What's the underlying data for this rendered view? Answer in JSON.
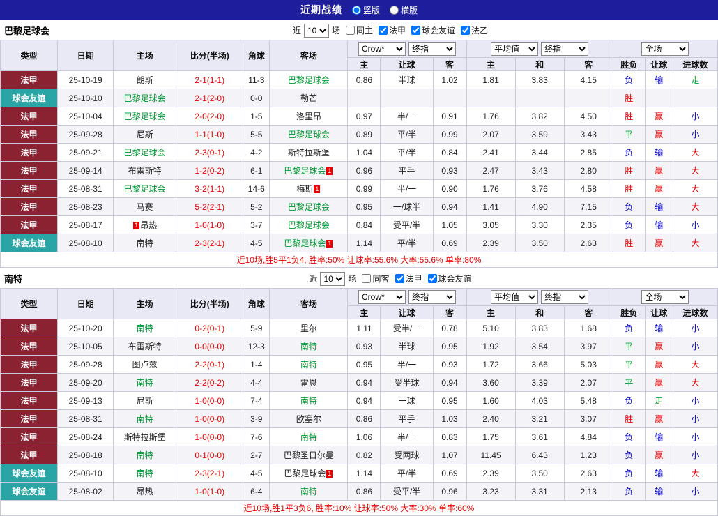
{
  "titlebar": {
    "title": "近期战绩",
    "radios": [
      {
        "label": "竖版",
        "selected": true
      },
      {
        "label": "横版",
        "selected": false
      }
    ]
  },
  "badge_text": "1",
  "colors": {
    "titlebar_bg": "#1e1e9c",
    "league": {
      "法甲": "#8b2232",
      "球会友谊": "#2aa5a5",
      "法乙": "#8b2232"
    },
    "team_highlight": "#009933",
    "score": "#e60000",
    "result": {
      "胜": "#e60000",
      "赢": "#e60000",
      "大": "#e60000",
      "平": "#009933",
      "走": "#009933",
      "负": "#0000cc",
      "输": "#0000cc",
      "小": "#0000cc"
    }
  },
  "sections": [
    {
      "team": "巴黎足球会",
      "filter": {
        "prefix": "近",
        "matches_value": "10",
        "suffix": "场",
        "checkboxes": [
          {
            "label": "同主",
            "checked": false
          },
          {
            "label": "法甲",
            "checked": true
          },
          {
            "label": "球会友谊",
            "checked": true
          },
          {
            "label": "法乙",
            "checked": true
          }
        ]
      },
      "header": {
        "static_cols": [
          "类型",
          "日期",
          "主场",
          "比分(半场)",
          "角球",
          "客场"
        ],
        "asian_dropdowns": [
          "Crow*",
          "终指"
        ],
        "euro_dropdowns": [
          "平均值",
          "终指"
        ],
        "fulltime_dropdown": "全场",
        "asian_sub": [
          "主",
          "让球",
          "客"
        ],
        "euro_sub": [
          "主",
          "和",
          "客"
        ],
        "result_sub": [
          "胜负",
          "让球",
          "进球数"
        ]
      },
      "rows": [
        {
          "league": "法甲",
          "date": "25-10-19",
          "home": {
            "name": "朗斯",
            "hl": false,
            "badge": null
          },
          "score": "2-1(1-1)",
          "corner": "11-3",
          "away": {
            "name": "巴黎足球会",
            "hl": true,
            "badge": null
          },
          "asian": [
            "0.86",
            "半球",
            "1.02"
          ],
          "euro": [
            "1.81",
            "3.83",
            "4.15"
          ],
          "results": [
            "负",
            "输",
            "走"
          ]
        },
        {
          "league": "球会友谊",
          "date": "25-10-10",
          "home": {
            "name": "巴黎足球会",
            "hl": true,
            "badge": null
          },
          "score": "2-1(2-0)",
          "corner": "0-0",
          "away": {
            "name": "勒芒",
            "hl": false,
            "badge": null
          },
          "asian": [
            "",
            "",
            ""
          ],
          "euro": [
            "",
            "",
            ""
          ],
          "results": [
            "胜",
            "",
            ""
          ]
        },
        {
          "league": "法甲",
          "date": "25-10-04",
          "home": {
            "name": "巴黎足球会",
            "hl": true,
            "badge": null
          },
          "score": "2-0(2-0)",
          "corner": "1-5",
          "away": {
            "name": "洛里昂",
            "hl": false,
            "badge": null
          },
          "asian": [
            "0.97",
            "半/一",
            "0.91"
          ],
          "euro": [
            "1.76",
            "3.82",
            "4.50"
          ],
          "results": [
            "胜",
            "赢",
            "小"
          ]
        },
        {
          "league": "法甲",
          "date": "25-09-28",
          "home": {
            "name": "尼斯",
            "hl": false,
            "badge": null
          },
          "score": "1-1(1-0)",
          "corner": "5-5",
          "away": {
            "name": "巴黎足球会",
            "hl": true,
            "badge": null
          },
          "asian": [
            "0.89",
            "平/半",
            "0.99"
          ],
          "euro": [
            "2.07",
            "3.59",
            "3.43"
          ],
          "results": [
            "平",
            "赢",
            "小"
          ]
        },
        {
          "league": "法甲",
          "date": "25-09-21",
          "home": {
            "name": "巴黎足球会",
            "hl": true,
            "badge": null
          },
          "score": "2-3(0-1)",
          "corner": "4-2",
          "away": {
            "name": "斯特拉斯堡",
            "hl": false,
            "badge": null
          },
          "asian": [
            "1.04",
            "平/半",
            "0.84"
          ],
          "euro": [
            "2.41",
            "3.44",
            "2.85"
          ],
          "results": [
            "负",
            "输",
            "大"
          ]
        },
        {
          "league": "法甲",
          "date": "25-09-14",
          "home": {
            "name": "布雷斯特",
            "hl": false,
            "badge": null
          },
          "score": "1-2(0-2)",
          "corner": "6-1",
          "away": {
            "name": "巴黎足球会",
            "hl": true,
            "badge": "after"
          },
          "asian": [
            "0.96",
            "平手",
            "0.93"
          ],
          "euro": [
            "2.47",
            "3.43",
            "2.80"
          ],
          "results": [
            "胜",
            "赢",
            "大"
          ]
        },
        {
          "league": "法甲",
          "date": "25-08-31",
          "home": {
            "name": "巴黎足球会",
            "hl": true,
            "badge": null
          },
          "score": "3-2(1-1)",
          "corner": "14-6",
          "away": {
            "name": "梅斯",
            "hl": false,
            "badge": "after"
          },
          "asian": [
            "0.99",
            "半/一",
            "0.90"
          ],
          "euro": [
            "1.76",
            "3.76",
            "4.58"
          ],
          "results": [
            "胜",
            "赢",
            "大"
          ]
        },
        {
          "league": "法甲",
          "date": "25-08-23",
          "home": {
            "name": "马赛",
            "hl": false,
            "badge": null
          },
          "score": "5-2(2-1)",
          "corner": "5-2",
          "away": {
            "name": "巴黎足球会",
            "hl": true,
            "badge": null
          },
          "asian": [
            "0.95",
            "一/球半",
            "0.94"
          ],
          "euro": [
            "1.41",
            "4.90",
            "7.15"
          ],
          "results": [
            "负",
            "输",
            "大"
          ]
        },
        {
          "league": "法甲",
          "date": "25-08-17",
          "home": {
            "name": "昂热",
            "hl": false,
            "badge": "before"
          },
          "score": "1-0(1-0)",
          "corner": "3-7",
          "away": {
            "name": "巴黎足球会",
            "hl": true,
            "badge": null
          },
          "asian": [
            "0.84",
            "受平/半",
            "1.05"
          ],
          "euro": [
            "3.05",
            "3.30",
            "2.35"
          ],
          "results": [
            "负",
            "输",
            "小"
          ]
        },
        {
          "league": "球会友谊",
          "date": "25-08-10",
          "home": {
            "name": "南特",
            "hl": false,
            "badge": null
          },
          "score": "2-3(2-1)",
          "corner": "4-5",
          "away": {
            "name": "巴黎足球会",
            "hl": true,
            "badge": "after"
          },
          "asian": [
            "1.14",
            "平/半",
            "0.69"
          ],
          "euro": [
            "2.39",
            "3.50",
            "2.63"
          ],
          "results": [
            "胜",
            "赢",
            "大"
          ]
        }
      ],
      "summary": "近10场,胜5平1负4, 胜率:50% 让球率:55.6% 大率:55.6% 单率:80%"
    },
    {
      "team": "南特",
      "filter": {
        "prefix": "近",
        "matches_value": "10",
        "suffix": "场",
        "checkboxes": [
          {
            "label": "同客",
            "checked": false
          },
          {
            "label": "法甲",
            "checked": true
          },
          {
            "label": "球会友谊",
            "checked": true
          }
        ]
      },
      "header": {
        "static_cols": [
          "类型",
          "日期",
          "主场",
          "比分(半场)",
          "角球",
          "客场"
        ],
        "asian_dropdowns": [
          "Crow*",
          "终指"
        ],
        "euro_dropdowns": [
          "平均值",
          "终指"
        ],
        "fulltime_dropdown": "全场",
        "asian_sub": [
          "主",
          "让球",
          "客"
        ],
        "euro_sub": [
          "主",
          "和",
          "客"
        ],
        "result_sub": [
          "胜负",
          "让球",
          "进球数"
        ]
      },
      "rows": [
        {
          "league": "法甲",
          "date": "25-10-20",
          "home": {
            "name": "南特",
            "hl": true,
            "badge": null
          },
          "score": "0-2(0-1)",
          "corner": "5-9",
          "away": {
            "name": "里尔",
            "hl": false,
            "badge": null
          },
          "asian": [
            "1.11",
            "受半/一",
            "0.78"
          ],
          "euro": [
            "5.10",
            "3.83",
            "1.68"
          ],
          "results": [
            "负",
            "输",
            "小"
          ]
        },
        {
          "league": "法甲",
          "date": "25-10-05",
          "home": {
            "name": "布雷斯特",
            "hl": false,
            "badge": null
          },
          "score": "0-0(0-0)",
          "corner": "12-3",
          "away": {
            "name": "南特",
            "hl": true,
            "badge": null
          },
          "asian": [
            "0.93",
            "半球",
            "0.95"
          ],
          "euro": [
            "1.92",
            "3.54",
            "3.97"
          ],
          "results": [
            "平",
            "赢",
            "小"
          ]
        },
        {
          "league": "法甲",
          "date": "25-09-28",
          "home": {
            "name": "图卢兹",
            "hl": false,
            "badge": null
          },
          "score": "2-2(0-1)",
          "corner": "1-4",
          "away": {
            "name": "南特",
            "hl": true,
            "badge": null
          },
          "asian": [
            "0.95",
            "半/一",
            "0.93"
          ],
          "euro": [
            "1.72",
            "3.66",
            "5.03"
          ],
          "results": [
            "平",
            "赢",
            "大"
          ]
        },
        {
          "league": "法甲",
          "date": "25-09-20",
          "home": {
            "name": "南特",
            "hl": true,
            "badge": null
          },
          "score": "2-2(0-2)",
          "corner": "4-4",
          "away": {
            "name": "雷恩",
            "hl": false,
            "badge": null
          },
          "asian": [
            "0.94",
            "受半球",
            "0.94"
          ],
          "euro": [
            "3.60",
            "3.39",
            "2.07"
          ],
          "results": [
            "平",
            "赢",
            "大"
          ]
        },
        {
          "league": "法甲",
          "date": "25-09-13",
          "home": {
            "name": "尼斯",
            "hl": false,
            "badge": null
          },
          "score": "1-0(0-0)",
          "corner": "7-4",
          "away": {
            "name": "南特",
            "hl": true,
            "badge": null
          },
          "asian": [
            "0.94",
            "一球",
            "0.95"
          ],
          "euro": [
            "1.60",
            "4.03",
            "5.48"
          ],
          "results": [
            "负",
            "走",
            "小"
          ]
        },
        {
          "league": "法甲",
          "date": "25-08-31",
          "home": {
            "name": "南特",
            "hl": true,
            "badge": null
          },
          "score": "1-0(0-0)",
          "corner": "3-9",
          "away": {
            "name": "欧塞尔",
            "hl": false,
            "badge": null
          },
          "asian": [
            "0.86",
            "平手",
            "1.03"
          ],
          "euro": [
            "2.40",
            "3.21",
            "3.07"
          ],
          "results": [
            "胜",
            "赢",
            "小"
          ]
        },
        {
          "league": "法甲",
          "date": "25-08-24",
          "home": {
            "name": "斯特拉斯堡",
            "hl": false,
            "badge": null
          },
          "score": "1-0(0-0)",
          "corner": "7-6",
          "away": {
            "name": "南特",
            "hl": true,
            "badge": null
          },
          "asian": [
            "1.06",
            "半/一",
            "0.83"
          ],
          "euro": [
            "1.75",
            "3.61",
            "4.84"
          ],
          "results": [
            "负",
            "输",
            "小"
          ]
        },
        {
          "league": "法甲",
          "date": "25-08-18",
          "home": {
            "name": "南特",
            "hl": true,
            "badge": null
          },
          "score": "0-1(0-0)",
          "corner": "2-7",
          "away": {
            "name": "巴黎圣日尔曼",
            "hl": false,
            "badge": null
          },
          "asian": [
            "0.82",
            "受两球",
            "1.07"
          ],
          "euro": [
            "11.45",
            "6.43",
            "1.23"
          ],
          "results": [
            "负",
            "赢",
            "小"
          ]
        },
        {
          "league": "球会友谊",
          "date": "25-08-10",
          "home": {
            "name": "南特",
            "hl": true,
            "badge": null
          },
          "score": "2-3(2-1)",
          "corner": "4-5",
          "away": {
            "name": "巴黎足球会",
            "hl": false,
            "badge": "after"
          },
          "asian": [
            "1.14",
            "平/半",
            "0.69"
          ],
          "euro": [
            "2.39",
            "3.50",
            "2.63"
          ],
          "results": [
            "负",
            "输",
            "大"
          ]
        },
        {
          "league": "球会友谊",
          "date": "25-08-02",
          "home": {
            "name": "昂热",
            "hl": false,
            "badge": null
          },
          "score": "1-0(1-0)",
          "corner": "6-4",
          "away": {
            "name": "南特",
            "hl": true,
            "badge": null
          },
          "asian": [
            "0.86",
            "受平/半",
            "0.96"
          ],
          "euro": [
            "3.23",
            "3.31",
            "2.13"
          ],
          "results": [
            "负",
            "输",
            "小"
          ]
        }
      ],
      "summary": "近10场,胜1平3负6, 胜率:10% 让球率:50% 大率:30% 单率:60%"
    }
  ]
}
